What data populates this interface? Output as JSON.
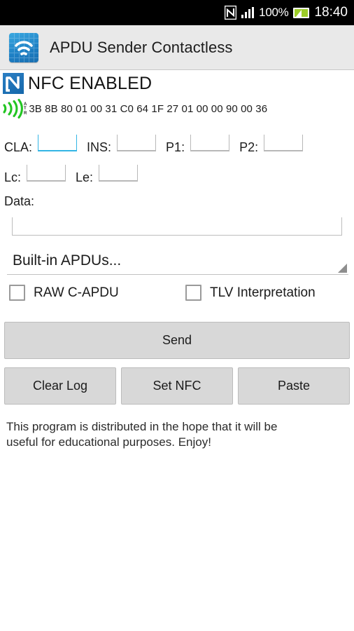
{
  "statusbar": {
    "nfc_icon": "nfc-n-icon",
    "signal_icon": "signal-bars-icon",
    "battery_percent": "100%",
    "battery_icon": "battery-charging-icon",
    "time": "18:40"
  },
  "actionbar": {
    "app_icon": "contactless-wifi-app-icon",
    "title": "APDU Sender Contactless"
  },
  "nfc_status": {
    "badge_icon": "nfc-logo-icon",
    "label": "NFC ENABLED"
  },
  "atr": {
    "wave_icon": "contactless-wave-icon",
    "tag_line1": "A",
    "tag_line2": "T",
    "tag_line3": "R",
    "value": "3B 8B 80 01 00 31 C0 64 1F 27 01 00 00 90 00 36"
  },
  "fields": {
    "cla": {
      "label": "CLA:",
      "value": "",
      "focused": true
    },
    "ins": {
      "label": "INS:",
      "value": "",
      "focused": false
    },
    "p1": {
      "label": "P1:",
      "value": "",
      "focused": false
    },
    "p2": {
      "label": "P2:",
      "value": "",
      "focused": false
    },
    "lc": {
      "label": "Lc:",
      "value": "",
      "focused": false
    },
    "le": {
      "label": "Le:",
      "value": "",
      "focused": false
    },
    "data": {
      "label": "Data:",
      "value": "",
      "placeholder": ""
    }
  },
  "spinner": {
    "selected": "Built-in APDUs...",
    "arrow_icon": "dropdown-triangle-icon"
  },
  "checkboxes": [
    {
      "label": "RAW C-APDU",
      "checked": false
    },
    {
      "label": "TLV Interpretation",
      "checked": false
    }
  ],
  "buttons": {
    "send": "Send",
    "clear_log": "Clear Log",
    "set_nfc": "Set NFC",
    "paste": "Paste"
  },
  "footer": {
    "line1": "This program is distributed in the hope that it will be",
    "line2": "useful for educational purposes.  Enjoy!"
  },
  "colors": {
    "accent_blue": "#33b5e5",
    "nfc_blue": "#1d7fc4",
    "wave_green": "#22c522",
    "statusbar_bg": "#000000",
    "actionbar_bg": "#e9e9e9",
    "button_bg": "#d8d8d8",
    "battery_green": "#9ccc28"
  }
}
